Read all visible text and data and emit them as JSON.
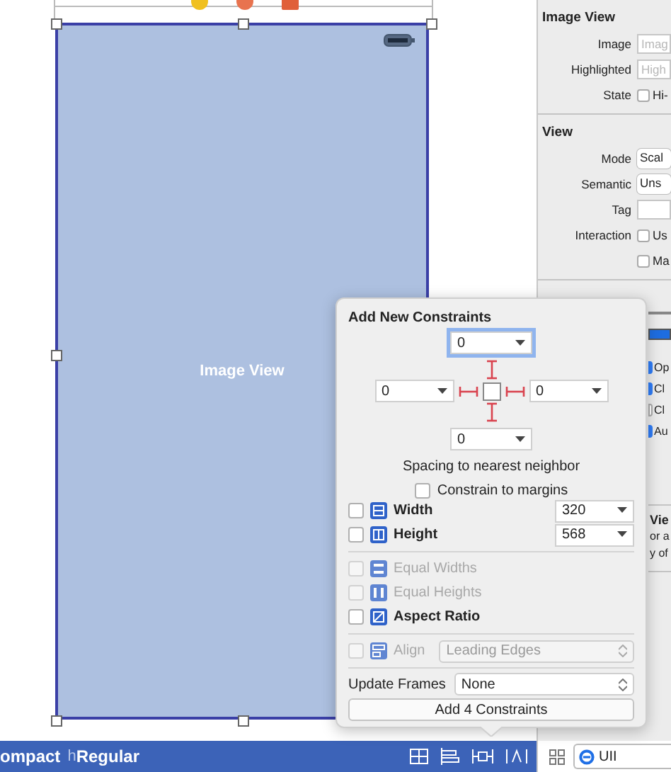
{
  "canvas": {
    "image_view": {
      "label": "Image View",
      "selected": true
    }
  },
  "inspector": {
    "sections": [
      {
        "title": "Image View",
        "rows": [
          {
            "kind": "field",
            "label": "Image",
            "placeholder": "Imag"
          },
          {
            "kind": "field",
            "label": "Highlighted",
            "placeholder": "High"
          },
          {
            "kind": "checkbox",
            "label": "State",
            "text": "Hi-",
            "checked": false
          }
        ]
      },
      {
        "title": "View",
        "rows": [
          {
            "kind": "popup",
            "label": "Mode",
            "value": "Scal"
          },
          {
            "kind": "popup",
            "label": "Semantic",
            "value": "Uns"
          },
          {
            "kind": "field",
            "label": "Tag"
          },
          {
            "kind": "checkbox",
            "label": "Interaction",
            "text": "Us",
            "checked": false
          },
          {
            "kind": "checkbox",
            "text": "Ma",
            "checked": false
          }
        ]
      }
    ],
    "drawing_checks": [
      {
        "text": "Op",
        "checked": true
      },
      {
        "text": "Cl",
        "checked": true
      },
      {
        "text": "Cl",
        "checked": false
      },
      {
        "text": "Au",
        "checked": true
      }
    ],
    "library_item": {
      "title": "Vie",
      "lines": [
        "or a",
        "y of"
      ]
    }
  },
  "popover": {
    "title": "Add New Constraints",
    "spacing": {
      "top": {
        "value": "0",
        "focused": true
      },
      "left": {
        "value": "0",
        "focused": false
      },
      "right": {
        "value": "0",
        "focused": false
      },
      "bottom": {
        "value": "0",
        "focused": false
      }
    },
    "spacing_caption": "Spacing to nearest neighbor",
    "constrain_to_margins": {
      "label": "Constrain to margins",
      "checked": false
    },
    "constraints": [
      {
        "kind": "size",
        "label": "Width",
        "checked": false,
        "disabled": false,
        "value": "320"
      },
      {
        "kind": "size",
        "label": "Height",
        "checked": false,
        "disabled": false,
        "value": "568"
      },
      {
        "kind": "plain",
        "label": "Equal Widths",
        "checked": false,
        "disabled": true
      },
      {
        "kind": "plain",
        "label": "Equal Heights",
        "checked": false,
        "disabled": true
      },
      {
        "kind": "plain",
        "label": "Aspect Ratio",
        "checked": false,
        "disabled": false
      },
      {
        "kind": "align",
        "label": "Align",
        "checked": false,
        "disabled": true,
        "value": "Leading Edges"
      }
    ],
    "update_frames": {
      "label": "Update Frames",
      "value": "None"
    },
    "add_button": "Add 4 Constraints"
  },
  "bottom_bar": {
    "width_class": "ompact",
    "height_prefix": "h",
    "height_class": "Regular"
  },
  "filter": {
    "value": "UII"
  }
}
